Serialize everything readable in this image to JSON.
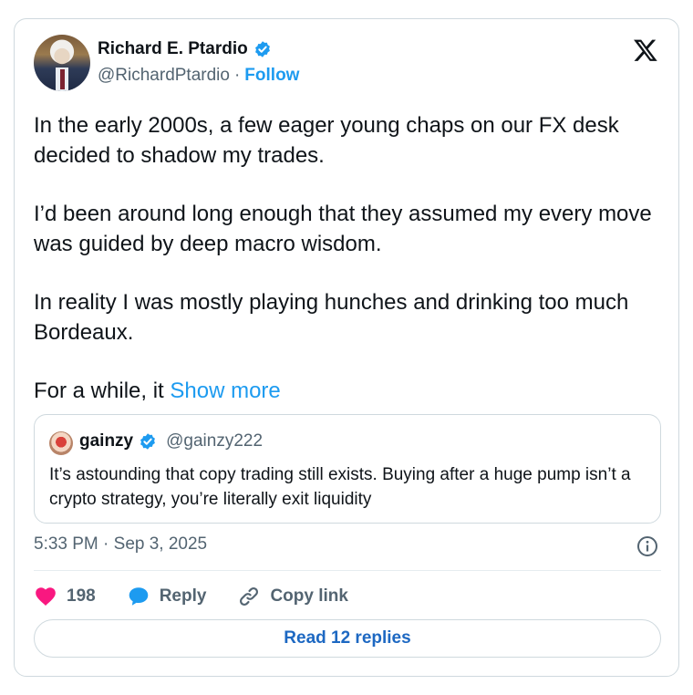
{
  "author": {
    "name": "Richard E. Ptardio",
    "handle": "@RichardPtardio",
    "separator": "·",
    "follow_label": "Follow"
  },
  "tweet": {
    "paragraphs": [
      "In the early 2000s, a few eager young chaps on our FX desk decided to shadow my trades.",
      "I’d been around long enough that they assumed my every move was guided by deep macro wisdom.",
      "In reality I was mostly playing hunches and drinking too much Bordeaux."
    ],
    "last_line": "For a while, it",
    "show_more": "Show more"
  },
  "quote": {
    "name": "gainzy",
    "handle": "@gainzy222",
    "text": "It’s astounding that copy trading still exists. Buying after a huge pump isn’t a crypto strategy, you’re literally exit liquidity"
  },
  "timestamp": "5:33 PM · Sep 3, 2025",
  "actions": {
    "likes": "198",
    "reply_label": "Reply",
    "copy_link_label": "Copy link"
  },
  "read_replies_label": "Read 12 replies",
  "colors": {
    "accent": "#1d9bf0",
    "heart": "#f91880",
    "reply_bubble": "#1d9bf0",
    "muted": "#536471"
  },
  "icons": [
    "x-logo-icon",
    "verified-badge-icon",
    "info-icon",
    "heart-icon",
    "reply-icon",
    "link-icon"
  ]
}
